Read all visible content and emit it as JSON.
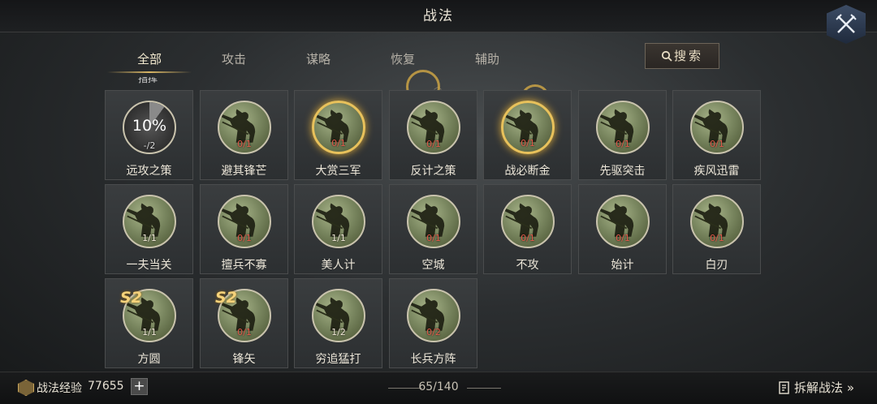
{
  "header": {
    "title": "战法"
  },
  "tabs": [
    {
      "label": "全部",
      "active": true
    },
    {
      "label": "攻击",
      "active": false
    },
    {
      "label": "谋略",
      "active": false
    },
    {
      "label": "恢复",
      "active": false
    },
    {
      "label": "辅助",
      "active": false
    }
  ],
  "search": {
    "label": "搜索"
  },
  "partial_row_label": "指挥",
  "skills": [
    {
      "name": "远攻之策",
      "level": "-/2",
      "progress": "10%",
      "style": "learning"
    },
    {
      "name": "避其锋芒",
      "level": "0/1",
      "style": "normal"
    },
    {
      "name": "大赏三军",
      "level": "0/1",
      "style": "gold"
    },
    {
      "name": "反计之策",
      "level": "0/1",
      "style": "normal"
    },
    {
      "name": "战必断金",
      "level": "0/1",
      "style": "gold"
    },
    {
      "name": "先驱突击",
      "level": "0/1",
      "style": "normal"
    },
    {
      "name": "疾风迅雷",
      "level": "0/1",
      "style": "normal"
    },
    {
      "name": "一夫当关",
      "level": "1/1",
      "style": "normal"
    },
    {
      "name": "擅兵不寡",
      "level": "0/1",
      "style": "normal"
    },
    {
      "name": "美人计",
      "level": "1/1",
      "style": "normal"
    },
    {
      "name": "空城",
      "level": "0/1",
      "style": "normal"
    },
    {
      "name": "不攻",
      "level": "0/1",
      "style": "normal"
    },
    {
      "name": "始计",
      "level": "0/1",
      "style": "normal"
    },
    {
      "name": "白刃",
      "level": "0/1",
      "style": "normal"
    },
    {
      "name": "方圆",
      "level": "1/1",
      "season": "S2",
      "style": "normal"
    },
    {
      "name": "锋矢",
      "level": "0/1",
      "season": "S2",
      "style": "normal"
    },
    {
      "name": "穷追猛打",
      "level": "1/2",
      "style": "normal"
    },
    {
      "name": "长兵方阵",
      "level": "0/2",
      "style": "normal"
    }
  ],
  "footer": {
    "exp_label": "战法经验",
    "exp_value": "77655",
    "plus_label": "+",
    "page_count": "65/140",
    "dismantle_label": "拆解战法 »"
  },
  "colors": {
    "gold": "#e8c15b",
    "zero_level": "#e25b4a",
    "accent": "#d9b665"
  }
}
